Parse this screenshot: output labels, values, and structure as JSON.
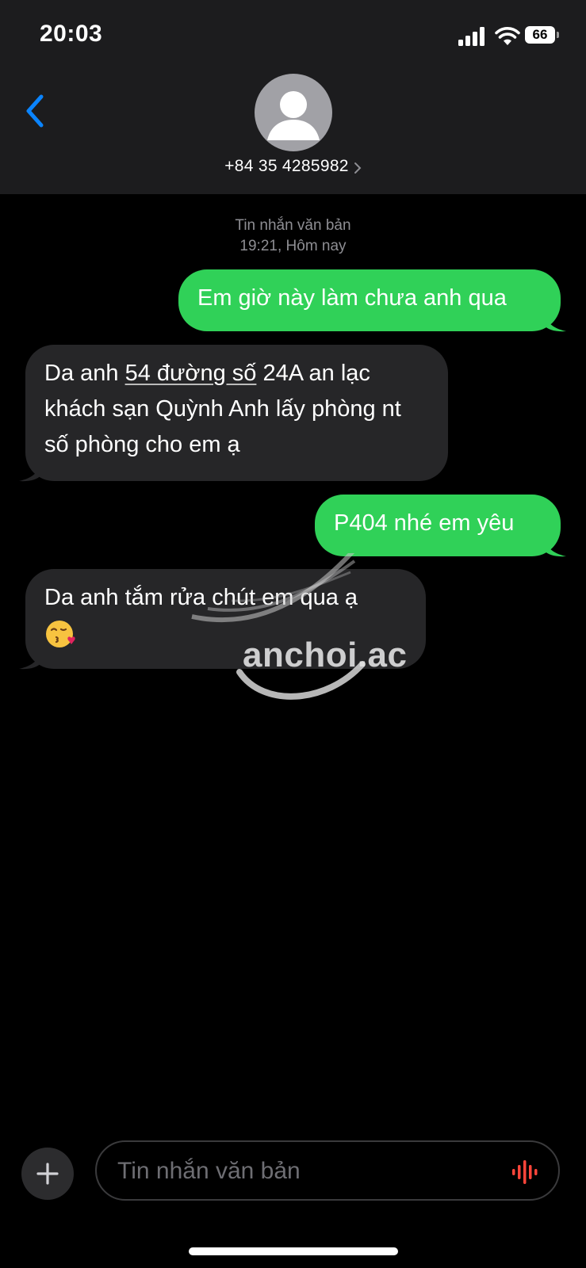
{
  "status_bar": {
    "time": "20:03",
    "battery_level": "66",
    "icons": [
      "cellular-signal-icon",
      "wifi-icon",
      "battery-icon"
    ]
  },
  "header": {
    "back_icon": "chevron-left-icon",
    "avatar_icon": "person-icon",
    "contact": "+84 35 4285982",
    "contact_chevron_icon": "chevron-right-icon"
  },
  "conversation": {
    "meta_type": "Tin nhắn văn bản",
    "meta_time": "19:21, Hôm nay",
    "messages": [
      {
        "direction": "out",
        "text": "Em giờ này làm chưa anh qua"
      },
      {
        "direction": "in",
        "text_before": "Da anh ",
        "text_link": "54 đường số",
        "text_after": " 24A an lạc khách sạn Quỳnh Anh lấy phòng nt số phòng cho em ạ"
      },
      {
        "direction": "out",
        "text": "P404 nhé em yêu"
      },
      {
        "direction": "in",
        "text": "Da anh tắm rửa chút em qua ạ",
        "emoji": "face-blowing-kiss-icon"
      }
    ]
  },
  "watermark": {
    "text": "anchoi.ac"
  },
  "composer": {
    "placeholder": "Tin nhắn văn bản",
    "add_icon": "plus-icon",
    "audio_icon": "waveform-icon"
  },
  "colors": {
    "outgoing_bubble": "#30d158",
    "incoming_bubble": "#262628",
    "accent_blue": "#0a84ff",
    "header_bg": "#1c1c1e"
  }
}
